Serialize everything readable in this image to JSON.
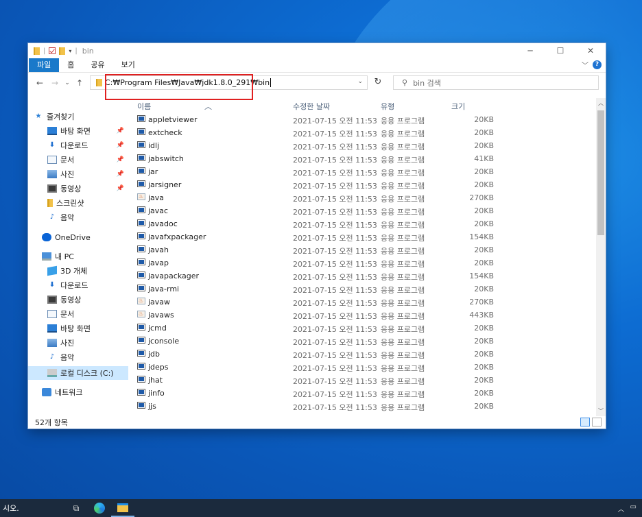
{
  "window": {
    "title": "bin",
    "controls": {
      "minimize": "─",
      "maximize": "☐",
      "close": "✕"
    }
  },
  "ribbon": {
    "tabs": [
      "파일",
      "홈",
      "공유",
      "보기"
    ]
  },
  "navigation": {
    "address_path": "C:₩Program Files₩Java₩jdk1.8.0_291₩bin",
    "search_placeholder": "bin 검색"
  },
  "sidebar": {
    "items": [
      {
        "label": "즐겨찾기",
        "icon": "star-icon",
        "pinned": false
      },
      {
        "label": "바탕 화면",
        "icon": "desktop-icon",
        "pinned": true
      },
      {
        "label": "다운로드",
        "icon": "download-icon",
        "pinned": true
      },
      {
        "label": "문서",
        "icon": "document-icon",
        "pinned": true
      },
      {
        "label": "사진",
        "icon": "pictures-icon",
        "pinned": true
      },
      {
        "label": "동영상",
        "icon": "video-icon",
        "pinned": true
      },
      {
        "label": "스크린샷",
        "icon": "folder-icon",
        "pinned": false
      },
      {
        "label": "음악",
        "icon": "music-icon",
        "pinned": false
      },
      {
        "label": "OneDrive",
        "icon": "cloud-icon",
        "pinned": false
      },
      {
        "label": "내 PC",
        "icon": "pc-icon",
        "pinned": false
      },
      {
        "label": "3D 개체",
        "icon": "3d-objects-icon",
        "pinned": false
      },
      {
        "label": "다운로드",
        "icon": "download-icon",
        "pinned": false
      },
      {
        "label": "동영상",
        "icon": "video-icon",
        "pinned": false
      },
      {
        "label": "문서",
        "icon": "document-icon",
        "pinned": false
      },
      {
        "label": "바탕 화면",
        "icon": "desktop-icon",
        "pinned": false
      },
      {
        "label": "사진",
        "icon": "pictures-icon",
        "pinned": false
      },
      {
        "label": "음악",
        "icon": "music-icon",
        "pinned": false
      },
      {
        "label": "로컬 디스크 (C:)",
        "icon": "drive-icon",
        "pinned": false,
        "selected": true
      },
      {
        "label": "네트워크",
        "icon": "network-icon",
        "pinned": false
      }
    ]
  },
  "file_list": {
    "columns": [
      "이름",
      "수정한 날짜",
      "유형",
      "크기"
    ],
    "rows": [
      {
        "name": "appletviewer",
        "date": "2021-07-15 오전 11:53",
        "type": "응용 프로그램",
        "size": "20KB",
        "icon": "exe-icon"
      },
      {
        "name": "extcheck",
        "date": "2021-07-15 오전 11:53",
        "type": "응용 프로그램",
        "size": "20KB",
        "icon": "exe-icon"
      },
      {
        "name": "idlj",
        "date": "2021-07-15 오전 11:53",
        "type": "응용 프로그램",
        "size": "20KB",
        "icon": "exe-icon"
      },
      {
        "name": "jabswitch",
        "date": "2021-07-15 오전 11:53",
        "type": "응용 프로그램",
        "size": "41KB",
        "icon": "exe-icon"
      },
      {
        "name": "jar",
        "date": "2021-07-15 오전 11:53",
        "type": "응용 프로그램",
        "size": "20KB",
        "icon": "exe-icon"
      },
      {
        "name": "jarsigner",
        "date": "2021-07-15 오전 11:53",
        "type": "응용 프로그램",
        "size": "20KB",
        "icon": "exe-icon"
      },
      {
        "name": "java",
        "date": "2021-07-15 오전 11:53",
        "type": "응용 프로그램",
        "size": "270KB",
        "icon": "java-icon"
      },
      {
        "name": "javac",
        "date": "2021-07-15 오전 11:53",
        "type": "응용 프로그램",
        "size": "20KB",
        "icon": "exe-icon"
      },
      {
        "name": "javadoc",
        "date": "2021-07-15 오전 11:53",
        "type": "응용 프로그램",
        "size": "20KB",
        "icon": "exe-icon"
      },
      {
        "name": "javafxpackager",
        "date": "2021-07-15 오전 11:53",
        "type": "응용 프로그램",
        "size": "154KB",
        "icon": "exe-icon"
      },
      {
        "name": "javah",
        "date": "2021-07-15 오전 11:53",
        "type": "응용 프로그램",
        "size": "20KB",
        "icon": "exe-icon"
      },
      {
        "name": "javap",
        "date": "2021-07-15 오전 11:53",
        "type": "응용 프로그램",
        "size": "20KB",
        "icon": "exe-icon"
      },
      {
        "name": "javapackager",
        "date": "2021-07-15 오전 11:53",
        "type": "응용 프로그램",
        "size": "154KB",
        "icon": "exe-icon"
      },
      {
        "name": "java-rmi",
        "date": "2021-07-15 오전 11:53",
        "type": "응용 프로그램",
        "size": "20KB",
        "icon": "exe-icon"
      },
      {
        "name": "javaw",
        "date": "2021-07-15 오전 11:53",
        "type": "응용 프로그램",
        "size": "270KB",
        "icon": "java-icon"
      },
      {
        "name": "javaws",
        "date": "2021-07-15 오전 11:53",
        "type": "응용 프로그램",
        "size": "443KB",
        "icon": "java-icon"
      },
      {
        "name": "jcmd",
        "date": "2021-07-15 오전 11:53",
        "type": "응용 프로그램",
        "size": "20KB",
        "icon": "exe-icon"
      },
      {
        "name": "jconsole",
        "date": "2021-07-15 오전 11:53",
        "type": "응용 프로그램",
        "size": "20KB",
        "icon": "exe-icon"
      },
      {
        "name": "jdb",
        "date": "2021-07-15 오전 11:53",
        "type": "응용 프로그램",
        "size": "20KB",
        "icon": "exe-icon"
      },
      {
        "name": "jdeps",
        "date": "2021-07-15 오전 11:53",
        "type": "응용 프로그램",
        "size": "20KB",
        "icon": "exe-icon"
      },
      {
        "name": "jhat",
        "date": "2021-07-15 오전 11:53",
        "type": "응용 프로그램",
        "size": "20KB",
        "icon": "exe-icon"
      },
      {
        "name": "jinfo",
        "date": "2021-07-15 오전 11:53",
        "type": "응용 프로그램",
        "size": "20KB",
        "icon": "exe-icon"
      },
      {
        "name": "jjs",
        "date": "2021-07-15 오전 11:53",
        "type": "응용 프로그램",
        "size": "20KB",
        "icon": "exe-icon"
      }
    ]
  },
  "status": {
    "item_count": "52개 항목"
  },
  "taskbar": {
    "search_text": "시오."
  },
  "colors": {
    "accent": "#1979ca",
    "highlight_box": "#e02020",
    "selection": "#cce8ff"
  }
}
